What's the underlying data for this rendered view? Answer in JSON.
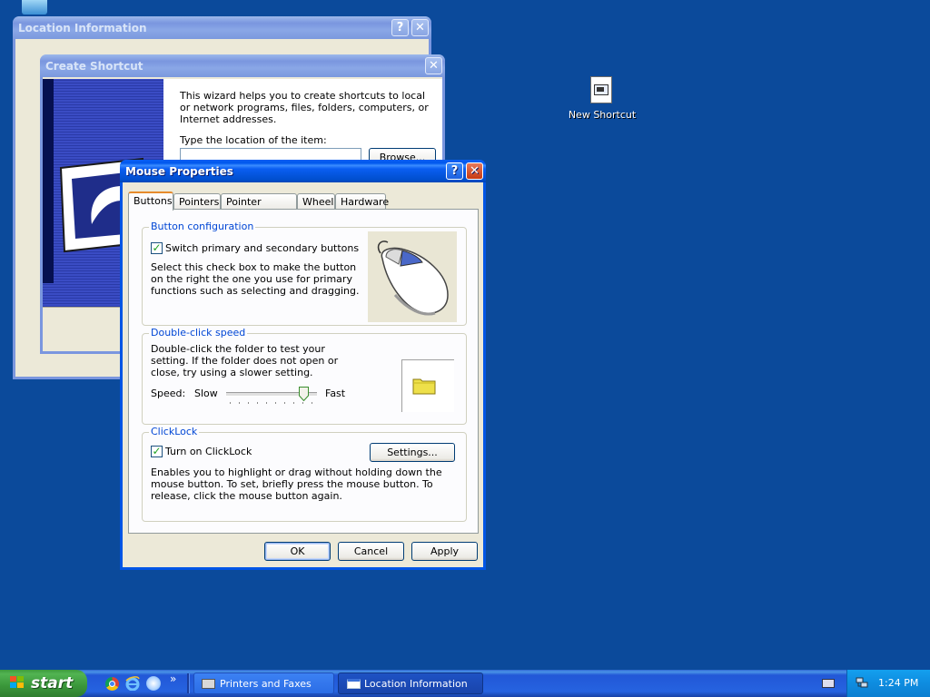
{
  "desktop": {
    "icon_label": "New Shortcut"
  },
  "location_window": {
    "title": "Location Information",
    "help": "?",
    "close": "✕"
  },
  "shortcut_window": {
    "title": "Create Shortcut",
    "close": "✕",
    "intro": "This wizard helps you to create shortcuts to local or network programs, files, folders, computers, or Internet addresses.",
    "location_label": "Type the location of the item:",
    "browse_label": "Browse..."
  },
  "mouse_window": {
    "title": "Mouse Properties",
    "help": "?",
    "close": "✕",
    "tabs": [
      "Buttons",
      "Pointers",
      "Pointer Options",
      "Wheel",
      "Hardware"
    ],
    "button_config": {
      "label": "Button configuration",
      "checkbox_label": "Switch primary and secondary buttons",
      "checked": "✓",
      "description": "Select this check box to make the button on the right the one you use for primary functions such as selecting and dragging."
    },
    "double_click": {
      "label": "Double-click speed",
      "description": "Double-click the folder to test your setting. If the folder does not open or close, try using a slower setting.",
      "speed_label": "Speed:",
      "slow_label": "Slow",
      "fast_label": "Fast",
      "slider_value": 0.9
    },
    "clicklock": {
      "label": "ClickLock",
      "checkbox_label": "Turn on ClickLock",
      "checked": "✓",
      "settings_label": "Settings...",
      "description": "Enables you to highlight or drag without holding down the mouse button. To set, briefly press the mouse button. To release, click the mouse button again."
    },
    "ok_label": "OK",
    "cancel_label": "Cancel",
    "apply_label": "Apply"
  },
  "taskbar": {
    "start_label": "start",
    "quicklaunch_more": "»",
    "tasks": [
      "Printers and Faxes",
      "Location Information"
    ],
    "clock": "1:24 PM"
  }
}
